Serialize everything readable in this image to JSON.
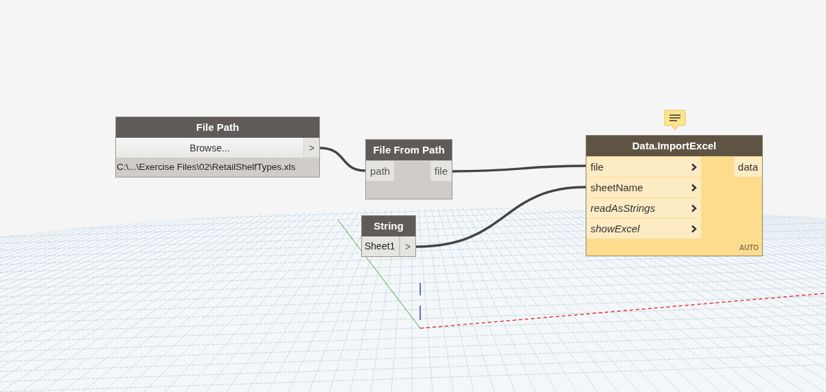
{
  "nodes": [
    {
      "kind": "file_path",
      "title": "File Path",
      "selected": false,
      "button": "Browse...",
      "arrow": ">",
      "value": "C:\\...\\Exercise Files\\02\\RetailShelfTypes.xls"
    },
    {
      "kind": "function",
      "title": "File From Path",
      "selected": false,
      "inputs": [
        {
          "name": "path",
          "optional": false
        }
      ],
      "outputs": [
        "file"
      ]
    },
    {
      "kind": "string",
      "title": "String",
      "selected": false,
      "value": "Sheet1",
      "arrow": ">"
    },
    {
      "kind": "function",
      "title": "Data.ImportExcel",
      "selected": true,
      "has_note": true,
      "lacing": "AUTO",
      "inputs": [
        {
          "name": "file",
          "optional": false
        },
        {
          "name": "sheetName",
          "optional": false
        },
        {
          "name": "readAsStrings",
          "optional": true
        },
        {
          "name": "showExcel",
          "optional": true
        }
      ],
      "outputs": [
        "data"
      ]
    }
  ]
}
